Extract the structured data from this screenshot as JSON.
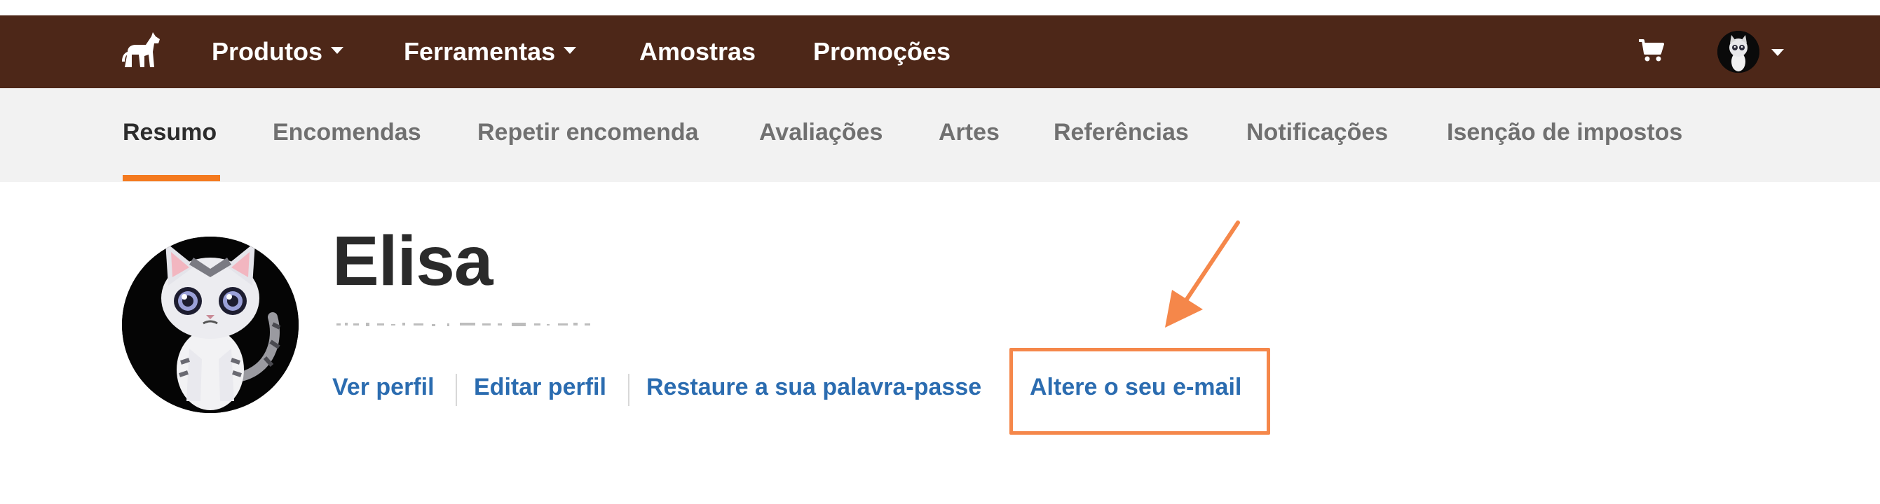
{
  "topnav": {
    "logo_icon": "horse-icon",
    "items": [
      {
        "label": "Produtos",
        "dropdown": true
      },
      {
        "label": "Ferramentas",
        "dropdown": true
      },
      {
        "label": "Amostras",
        "dropdown": false
      },
      {
        "label": "Promoções",
        "dropdown": false
      }
    ],
    "cart_icon": "cart-icon",
    "user_avatar_icon": "cat-avatar-icon",
    "colors": {
      "background": "#4d2718",
      "text": "#ffffff"
    }
  },
  "subnav": {
    "tabs": [
      {
        "label": "Resumo",
        "active": true
      },
      {
        "label": "Encomendas"
      },
      {
        "label": "Repetir encomenda"
      },
      {
        "label": "Avaliações"
      },
      {
        "label": "Artes"
      },
      {
        "label": "Referências"
      },
      {
        "label": "Notificações"
      },
      {
        "label": "Isenção de impostos"
      }
    ],
    "colors": {
      "background": "#f2f2f2",
      "active_underline": "#f47a1f"
    }
  },
  "profile": {
    "name": "Elisa",
    "avatar_icon": "cat-avatar-icon",
    "links": [
      {
        "label": "Ver perfil"
      },
      {
        "label": "Editar perfil"
      },
      {
        "label": "Restaure a sua palavra-passe"
      },
      {
        "label": "Altere o seu e-mail",
        "highlighted": true
      }
    ],
    "link_color": "#2b6cb0"
  },
  "annotation": {
    "color": "#f5874a",
    "arrow_icon": "pointer-arrow-icon"
  }
}
